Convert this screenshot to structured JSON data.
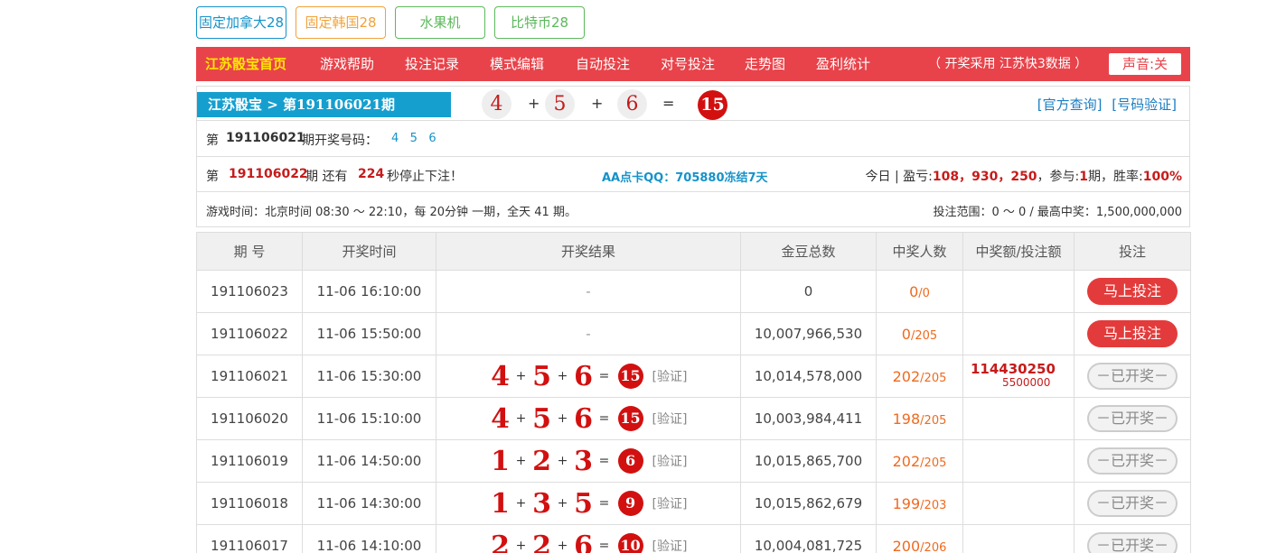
{
  "top_tabs": [
    {
      "label": "固定加拿大28",
      "color": "#1593c9"
    },
    {
      "label": "固定韩国28",
      "color": "#f0a33a"
    },
    {
      "label": "水果机",
      "color": "#5cb85c"
    },
    {
      "label": "比特币28",
      "color": "#5cb85c"
    }
  ],
  "nav": {
    "items": [
      "江苏骰宝首页",
      "游戏帮助",
      "投注记录",
      "模式编辑",
      "自动投注",
      "对号投注",
      "走势图",
      "盈利统计"
    ],
    "source": "（ 开奖采用 江苏快3数据 ）",
    "sound": "声音:关"
  },
  "latest": {
    "title": "江苏骰宝 > 第191106021期",
    "numbers": [
      "4",
      "5",
      "6"
    ],
    "plus": "+",
    "equals": "=",
    "sum": "15",
    "link_official": "[官方查询]",
    "link_verify": "[号码验证]"
  },
  "draw_line": {
    "prefix": "第",
    "issue": "191106021",
    "suffix": "期开奖号码：",
    "numbers": "4   5   6"
  },
  "countdown": {
    "prefix": "第",
    "issue": "191106022",
    "mid": "期 还有",
    "seconds": "224",
    "suffix": "秒停止下注！",
    "promo": "AA点卡QQ：705880冻结7天",
    "today_prefix": "今日 | 盈亏:",
    "profit": "108，930，250",
    "join_prefix": "，参与:",
    "join_count": "1",
    "join_suffix": "期，胜率:",
    "win_rate": "100%"
  },
  "schedule": {
    "text": "游戏时间：北京时间 08:30 ～ 22:10，每 20分钟 一期，全天 41 期。",
    "range": "投注范围：0 ～ 0 / 最高中奖：1,500,000,000"
  },
  "table": {
    "headers": [
      "期 号",
      "开奖时间",
      "开奖结果",
      "金豆总数",
      "中奖人数",
      "中奖额/投注额",
      "投注"
    ],
    "rows": [
      {
        "issue": "191106023",
        "time": "11-06 16:10:00",
        "result": null,
        "placeholder": "-",
        "total": "0",
        "winners": "0",
        "players": "0",
        "prize": "",
        "bet": "",
        "action": "马上投注",
        "open": true
      },
      {
        "issue": "191106022",
        "time": "11-06 15:50:00",
        "result": null,
        "placeholder": "-",
        "total": "10,007,966,530",
        "winners": "0",
        "players": "205",
        "prize": "",
        "bet": "",
        "action": "马上投注",
        "open": true
      },
      {
        "issue": "191106021",
        "time": "11-06 15:30:00",
        "result": [
          "4",
          "5",
          "6"
        ],
        "sum": "15",
        "verify": "[验证]",
        "total": "10,014,578,000",
        "winners": "202",
        "players": "205",
        "prize": "114430250",
        "bet": "5500000",
        "action": "－已开奖－",
        "open": false
      },
      {
        "issue": "191106020",
        "time": "11-06 15:10:00",
        "result": [
          "4",
          "5",
          "6"
        ],
        "sum": "15",
        "verify": "[验证]",
        "total": "10,003,984,411",
        "winners": "198",
        "players": "205",
        "prize": "",
        "bet": "",
        "action": "－已开奖－",
        "open": false
      },
      {
        "issue": "191106019",
        "time": "11-06 14:50:00",
        "result": [
          "1",
          "2",
          "3"
        ],
        "sum": "6",
        "verify": "[验证]",
        "total": "10,015,865,700",
        "winners": "202",
        "players": "205",
        "prize": "",
        "bet": "",
        "action": "－已开奖－",
        "open": false
      },
      {
        "issue": "191106018",
        "time": "11-06 14:30:00",
        "result": [
          "1",
          "3",
          "5"
        ],
        "sum": "9",
        "verify": "[验证]",
        "total": "10,015,862,679",
        "winners": "199",
        "players": "203",
        "prize": "",
        "bet": "",
        "action": "－已开奖－",
        "open": false
      },
      {
        "issue": "191106017",
        "time": "11-06 14:10:00",
        "result": [
          "2",
          "2",
          "6"
        ],
        "sum": "10",
        "verify": "[验证]",
        "total": "10,004,081,725",
        "winners": "200",
        "players": "206",
        "prize": "",
        "bet": "",
        "action": "－已开奖－",
        "open": false
      }
    ]
  }
}
